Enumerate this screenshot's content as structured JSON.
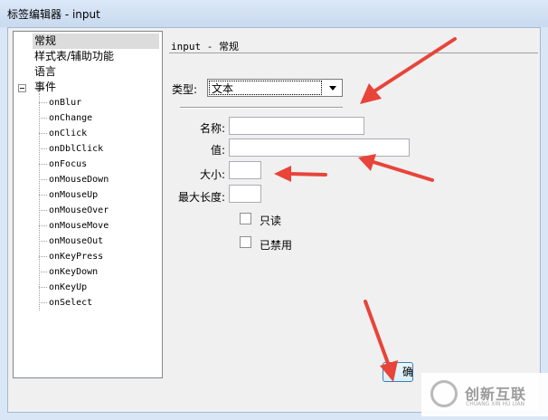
{
  "window": {
    "title": "标签编辑器 - input"
  },
  "tree": {
    "categories": [
      "常规",
      "样式表/辅助功能",
      "语言",
      "事件"
    ],
    "events": [
      "onBlur",
      "onChange",
      "onClick",
      "onDblClick",
      "onFocus",
      "onMouseDown",
      "onMouseUp",
      "onMouseOver",
      "onMouseMove",
      "onMouseOut",
      "onKeyPress",
      "onKeyDown",
      "onKeyUp",
      "onSelect"
    ]
  },
  "panel": {
    "title": "input - 常规",
    "type_label": "类型:",
    "type_value": "文本",
    "name_label": "名称:",
    "value_label": "值:",
    "size_label": "大小:",
    "maxlength_label": "最大长度:",
    "readonly_label": "只读",
    "disabled_label": "已禁用"
  },
  "footer": {
    "ok_label": "确"
  },
  "watermark": {
    "text_cn": "创新互联",
    "text_en": "CHUANG XIN HU LIAN"
  },
  "colors": {
    "annotation_arrow": "#e8443a",
    "selection": "#dcdcdc",
    "focus_button_border": "#3c7fb1"
  }
}
